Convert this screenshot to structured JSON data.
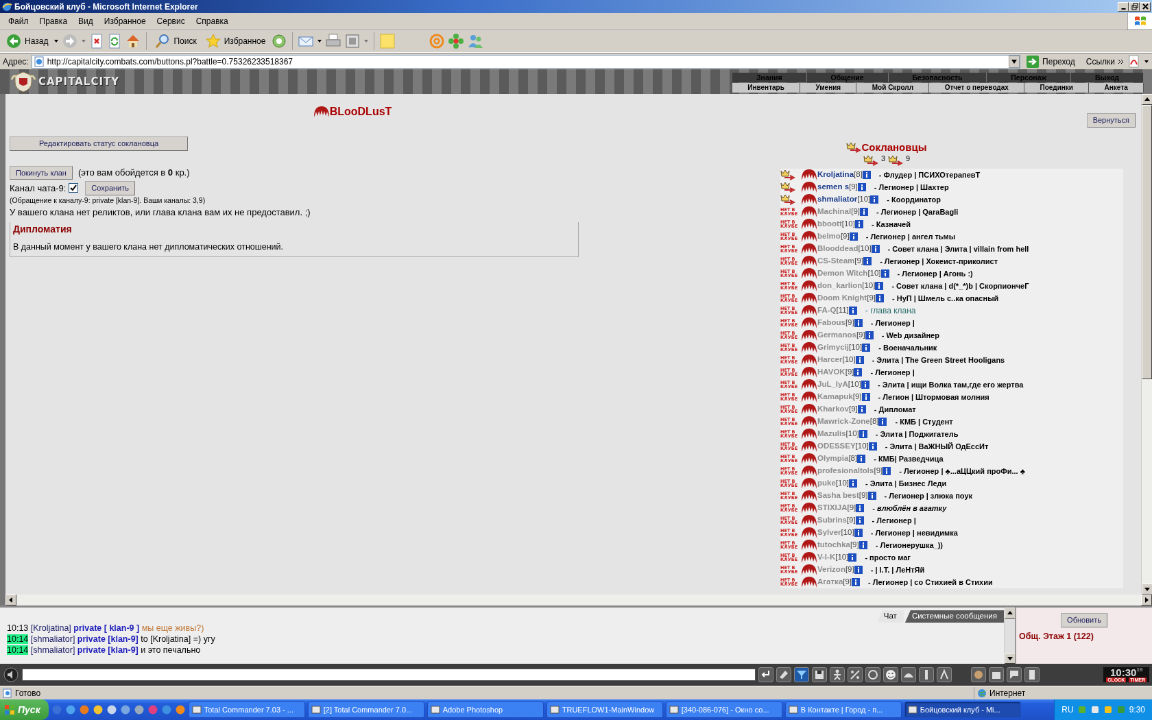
{
  "window": {
    "title": "Бойцовский клуб - Microsoft Internet Explorer"
  },
  "menu": [
    "Файл",
    "Правка",
    "Вид",
    "Избранное",
    "Сервис",
    "Справка"
  ],
  "toolbar": {
    "back": "Назад",
    "search": "Поиск",
    "favorites": "Избранное"
  },
  "address": {
    "label": "Адрес:",
    "url": "http://capitalcity.combats.com/buttons.pl?battle=0.75326233518367",
    "go": "Переход",
    "links": "Ссылки"
  },
  "game_header": {
    "logo": "CAPITALCITY",
    "nav": [
      "Знания",
      "Общение",
      "Безопасность",
      "Персонаж",
      "Выход"
    ],
    "subnav": [
      "Инвентарь",
      "Умения",
      "Мой Скролл",
      "Отчет о переводах",
      "Поединки",
      "Анкета"
    ]
  },
  "clan": {
    "name": "BLooDLusT",
    "back_button": "Вернуться",
    "edit_status_button": "Редактировать статус соклановца",
    "leave_button": "Покинуть клан",
    "leave_note": "(это вам обойдется в **0** кр.)",
    "channel_label": "Канал чата-9:",
    "channel_checked": true,
    "save_button": "Сохранить",
    "channel_note": "(Обращение к каналу-9: private [klan-9]. Ваши каналы: 3,9)",
    "relics_note": "У вашего клана нет реликтов, или глава клана вам их не предоставил. ;)",
    "diplomacy": {
      "title": "Дипломатия",
      "text": "В данный момент у вашего клана нет дипломатических отношений."
    }
  },
  "members_panel": {
    "title": "Соклановцы",
    "ranks": [
      "3",
      "9"
    ]
  },
  "members": [
    {
      "name": "Kroljatina",
      "rank": "[8]",
      "status": "- Флудер | ПСИХОтерапевТ",
      "kind": "normal",
      "online": true
    },
    {
      "name": "semen s",
      "rank": "[9]",
      "status": "- Легионер | Шахтер",
      "kind": "normal",
      "online": true
    },
    {
      "name": "shmaliator",
      "rank": "[10]",
      "status": "- Координатор",
      "kind": "normal",
      "online": true
    },
    {
      "name": "Machinal",
      "rank": "[9]",
      "status": "- Легионер | QaraBagli",
      "kind": "normal",
      "online": false,
      "offline_label": "НЕТ В КЛУБЕ"
    },
    {
      "name": "bboott",
      "rank": "[10]",
      "status": "- Казначей",
      "kind": "normal",
      "online": false,
      "offline_label": "НЕТ В КЛУБЕ"
    },
    {
      "name": "belmo",
      "rank": "[9]",
      "status": "- Легионер | ангел тьмы",
      "kind": "normal",
      "online": false,
      "offline_label": "НЕТ В КЛУБЕ"
    },
    {
      "name": "Blooddead",
      "rank": "[10]",
      "status": "- Совет клана | Элита | villain from hell",
      "kind": "normal",
      "online": false,
      "offline_label": "НЕТ В КЛУБЕ"
    },
    {
      "name": "CS-Steam",
      "rank": "[9]",
      "status": "- Легионер | Хокеист-приколист",
      "kind": "normal",
      "online": false,
      "offline_label": "НЕТ В КЛУБЕ"
    },
    {
      "name": "Demon Witch",
      "rank": "[10]",
      "status": "- Легионер | Агонь :)",
      "kind": "normal",
      "online": false,
      "offline_label": "НЕТ В КЛУБЕ"
    },
    {
      "name": "don_karlion",
      "rank": "[10]",
      "status": "- Совет клана | d(*_*)b | СкорпиончеГ",
      "kind": "normal",
      "online": false,
      "offline_label": "НЕТ В КЛУБЕ"
    },
    {
      "name": "Doom Knight",
      "rank": "[9]",
      "status": "- НуП | Шмель с..ка опасный",
      "kind": "normal",
      "online": false,
      "offline_label": "НЕТ В КЛУБЕ"
    },
    {
      "name": "FA-Q",
      "rank": "[11]",
      "status": "- глава клана",
      "kind": "head",
      "online": false,
      "offline_label": "НЕТ В КЛУБЕ"
    },
    {
      "name": "Fabous",
      "rank": "[9]",
      "status": "- Легионер |",
      "kind": "normal",
      "online": false,
      "offline_label": "НЕТ В КЛУБЕ"
    },
    {
      "name": "Germanos",
      "rank": "[9]",
      "status": "- Web дизайнер",
      "kind": "normal",
      "online": false,
      "offline_label": "НЕТ В КЛУБЕ"
    },
    {
      "name": "Grimycij",
      "rank": "[10]",
      "status": "- Военачальник",
      "kind": "normal",
      "online": false,
      "offline_label": "НЕТ В КЛУБЕ"
    },
    {
      "name": "Harcer",
      "rank": "[10]",
      "status": "- Элита | The Green Street Hooligans",
      "kind": "normal",
      "online": false,
      "offline_label": "НЕТ В КЛУБЕ"
    },
    {
      "name": "HAVOK",
      "rank": "[9]",
      "status": "- Легионер |",
      "kind": "normal",
      "online": false,
      "offline_label": "НЕТ В КЛУБЕ"
    },
    {
      "name": "JuL_IyA",
      "rank": "[10]",
      "status": "- Элита | ищи Волка там,где его жертва",
      "kind": "normal",
      "online": false,
      "offline_label": "НЕТ В КЛУБЕ"
    },
    {
      "name": "Kamapuk",
      "rank": "[9]",
      "status": "- Легион | Штормовая молния",
      "kind": "normal",
      "online": false,
      "offline_label": "НЕТ В КЛУБЕ"
    },
    {
      "name": "Kharkov",
      "rank": "[9]",
      "status": "- Дипломат",
      "kind": "normal",
      "online": false,
      "offline_label": "НЕТ В КЛУБЕ"
    },
    {
      "name": "Mawrick-Zone",
      "rank": "[8]",
      "status": "- КМБ | Студент",
      "kind": "normal",
      "online": false,
      "offline_label": "НЕТ В КЛУБЕ"
    },
    {
      "name": "Mazulis",
      "rank": "[10]",
      "status": "- Элита | Поджигатель",
      "kind": "normal",
      "online": false,
      "offline_label": "НЕТ В КЛУБЕ"
    },
    {
      "name": "ODESSEY",
      "rank": "[10]",
      "status": "- Элита | ВаЖНЫЙ ОдЕссИт",
      "kind": "normal",
      "online": false,
      "offline_label": "НЕТ В КЛУБЕ"
    },
    {
      "name": "Olympia",
      "rank": "[8]",
      "status": "- КМБ| Разведчица",
      "kind": "normal",
      "online": false,
      "offline_label": "НЕТ В КЛУБЕ"
    },
    {
      "name": "profesionaltols",
      "rank": "[9]",
      "status": "- Легионер | ♣...аЦЦкий проФи... ♣",
      "kind": "normal",
      "online": false,
      "offline_label": "НЕТ В КЛУБЕ"
    },
    {
      "name": "puke",
      "rank": "[10]",
      "status": "- Элита | Бизнес Леди",
      "kind": "normal",
      "online": false,
      "offline_label": "НЕТ В КЛУБЕ"
    },
    {
      "name": "Sasha best",
      "rank": "[9]",
      "status": "- Легионер | злюка поук",
      "kind": "normal",
      "online": false,
      "offline_label": "НЕТ В КЛУБЕ"
    },
    {
      "name": "STIXIJA",
      "rank": "[9]",
      "status": "- влюблён в агатку",
      "kind": "italic",
      "online": false,
      "offline_label": "НЕТ В КЛУБЕ"
    },
    {
      "name": "Subrins",
      "rank": "[9]",
      "status": "- Легионер |",
      "kind": "normal",
      "online": false,
      "offline_label": "НЕТ В КЛУБЕ"
    },
    {
      "name": "Sylver",
      "rank": "[10]",
      "status": "- Легионер | невидимка",
      "kind": "normal",
      "online": false,
      "offline_label": "НЕТ В КЛУБЕ"
    },
    {
      "name": "tutochka",
      "rank": "[9]",
      "status": "- Легионерушка_))",
      "kind": "normal",
      "online": false,
      "offline_label": "НЕТ В КЛУБЕ"
    },
    {
      "name": "V-I-K",
      "rank": "[10]",
      "status": "- просто маг",
      "kind": "normal",
      "online": false,
      "offline_label": "НЕТ В КЛУБЕ"
    },
    {
      "name": "Verizon",
      "rank": "[9]",
      "status": "- | I.T. | ЛеНтЯй",
      "kind": "normal",
      "online": false,
      "offline_label": "НЕТ В КЛУБЕ"
    },
    {
      "name": "Агатка",
      "rank": "[9]",
      "status": "- Легионер | со Стихией в Стихии",
      "kind": "normal",
      "online": false,
      "offline_label": "НЕТ В КЛУБЕ"
    }
  ],
  "chat": {
    "tabs": [
      {
        "label": "Чат",
        "selected": true
      },
      {
        "label": "Системные сообщения",
        "selected": false
      }
    ],
    "lines": [
      {
        "time": "10:13",
        "highlight": false,
        "sender": "[Kroljatina]",
        "channel": "private [ klan-9 ]",
        "text": "мы еще живы?)",
        "kind": "incoming"
      },
      {
        "time": "10:14",
        "highlight": true,
        "sender": "[shmaliator]",
        "channel": "private [klan-9]",
        "text": "to [Kroljatina] =) угу",
        "kind": "own"
      },
      {
        "time": "10:14",
        "highlight": true,
        "sender": "[shmaliator]",
        "channel": "private [klan-9]",
        "text": "и это печально",
        "kind": "own"
      }
    ],
    "refresh_button": "Обновить",
    "room": "Общ. Этаж 1 (122)"
  },
  "clock": {
    "time": "10:30",
    "seconds": "19",
    "labels": [
      "CLOCK",
      "TIMER"
    ]
  },
  "status_bar": {
    "text": "Готово",
    "zone": "Интернет"
  },
  "taskbar": {
    "start": "Пуск",
    "tasks": [
      {
        "label": "Total Commander 7.03 - ...",
        "selected": false
      },
      {
        "label": "[2] Total Commander 7.0...",
        "selected": false
      },
      {
        "label": "Adobe Photoshop",
        "selected": false
      },
      {
        "label": "TRUEFLOW1-MainWindow",
        "selected": false
      },
      {
        "label": "[340-086-076] - Окно со...",
        "selected": false
      },
      {
        "label": "В Контакте | Город - п...",
        "selected": false
      },
      {
        "label": "Бойцовский клуб - Mi...",
        "selected": true
      }
    ],
    "lang": "RU",
    "time": "9:30"
  }
}
